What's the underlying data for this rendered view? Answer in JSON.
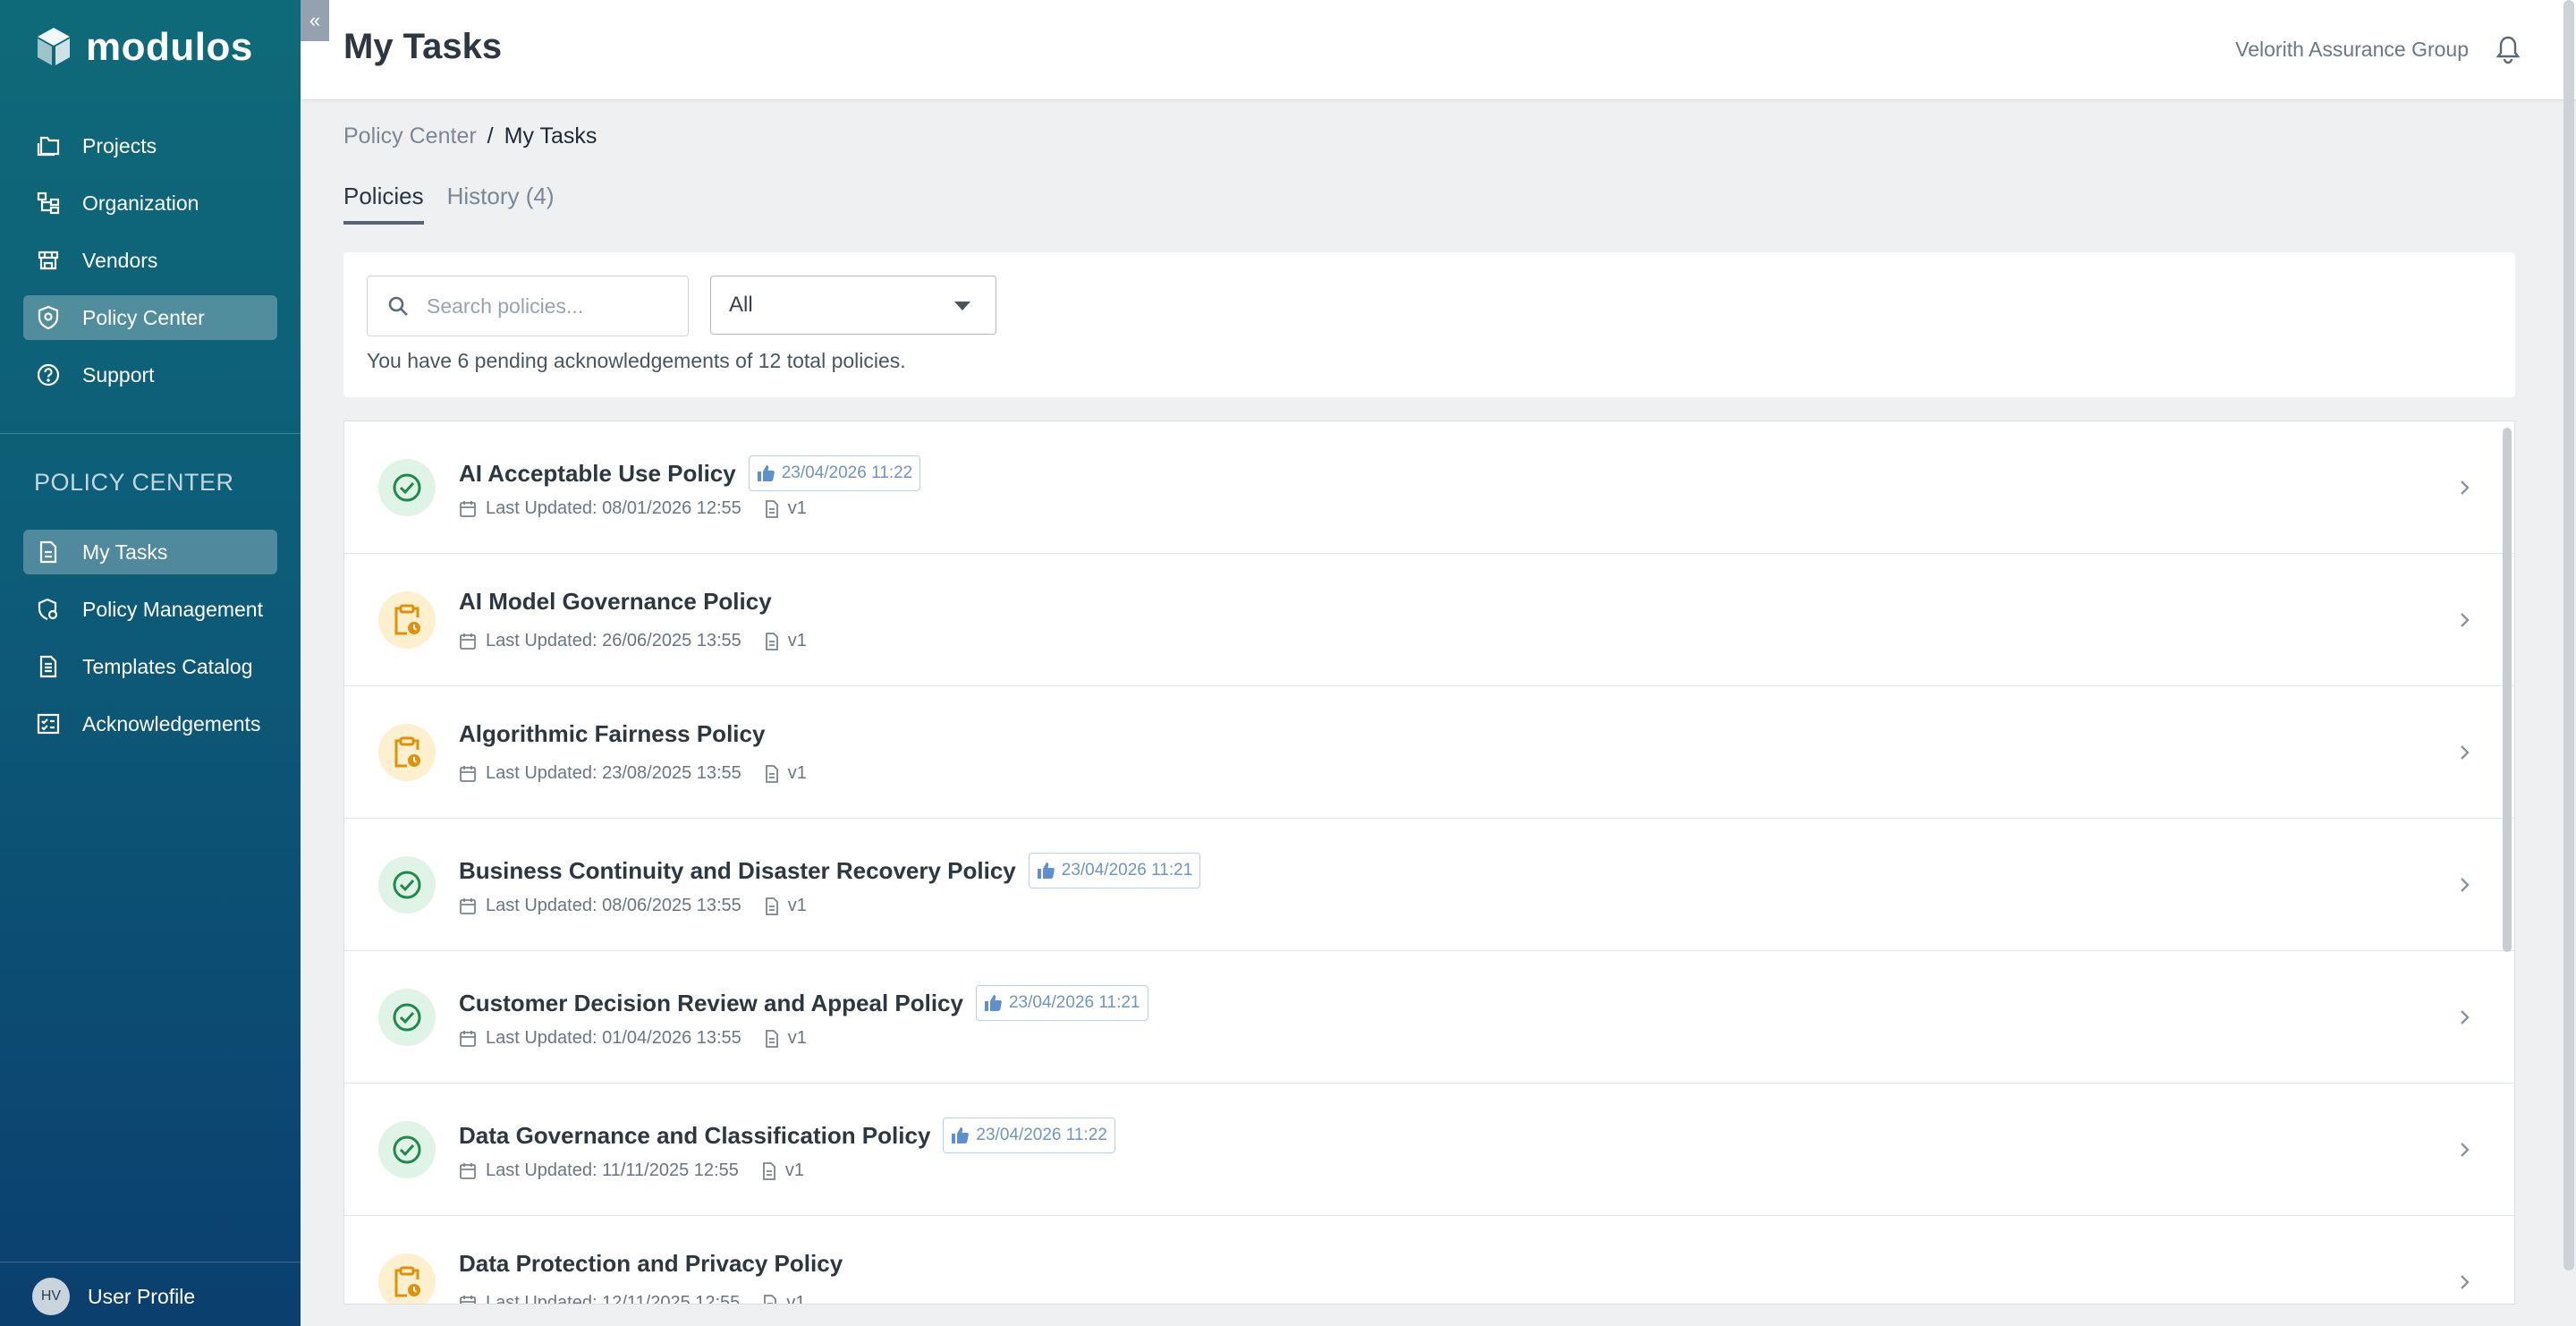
{
  "app": {
    "logo_text": "modulos",
    "collapse_glyph": "«"
  },
  "sidebar": {
    "items": [
      {
        "label": "Projects",
        "icon": "folder-icon"
      },
      {
        "label": "Organization",
        "icon": "org-chart-icon"
      },
      {
        "label": "Vendors",
        "icon": "store-icon"
      },
      {
        "label": "Policy Center",
        "icon": "shield-icon",
        "active": true
      },
      {
        "label": "Support",
        "icon": "help-circle-icon"
      }
    ],
    "section_title": "POLICY CENTER",
    "section_items": [
      {
        "label": "My Tasks",
        "icon": "document-icon",
        "active": true
      },
      {
        "label": "Policy Management",
        "icon": "policy-settings-icon"
      },
      {
        "label": "Templates Catalog",
        "icon": "template-icon"
      },
      {
        "label": "Acknowledgements",
        "icon": "checklist-icon"
      }
    ],
    "profile": {
      "initials": "HV",
      "label": "User Profile"
    }
  },
  "header": {
    "title": "My Tasks",
    "org": "Velorith Assurance Group"
  },
  "breadcrumb": {
    "parent": "Policy Center",
    "separator": "/",
    "current": "My Tasks"
  },
  "tabs": [
    {
      "label": "Policies",
      "active": true
    },
    {
      "label": "History (4)"
    }
  ],
  "filters": {
    "search_placeholder": "Search policies...",
    "select_value": "All",
    "summary": "You have 6 pending acknowledgements of 12 total policies."
  },
  "policies": [
    {
      "title": "AI Acceptable Use Policy",
      "status": "done",
      "ack": "23/04/2026 11:22",
      "updated": "Last Updated: 08/01/2026 12:55",
      "version": "v1"
    },
    {
      "title": "AI Model Governance Policy",
      "status": "pending",
      "ack": "",
      "updated": "Last Updated: 26/06/2025 13:55",
      "version": "v1"
    },
    {
      "title": "Algorithmic Fairness Policy",
      "status": "pending",
      "ack": "",
      "updated": "Last Updated: 23/08/2025 13:55",
      "version": "v1"
    },
    {
      "title": "Business Continuity and Disaster Recovery Policy",
      "status": "done",
      "ack": "23/04/2026 11:21",
      "updated": "Last Updated: 08/06/2025 13:55",
      "version": "v1"
    },
    {
      "title": "Customer Decision Review and Appeal Policy",
      "status": "done",
      "ack": "23/04/2026 11:21",
      "updated": "Last Updated: 01/04/2026 13:55",
      "version": "v1"
    },
    {
      "title": "Data Governance and Classification Policy",
      "status": "done",
      "ack": "23/04/2026 11:22",
      "updated": "Last Updated: 11/11/2025 12:55",
      "version": "v1"
    },
    {
      "title": "Data Protection and Privacy Policy",
      "status": "pending",
      "ack": "",
      "updated": "Last Updated: 12/11/2025 12:55",
      "version": "v1"
    }
  ],
  "colors": {
    "done": "#1f8a4c",
    "pending": "#e0900a",
    "sidebar_top": "#0e6a78",
    "sidebar_bottom": "#0b3f6e"
  }
}
